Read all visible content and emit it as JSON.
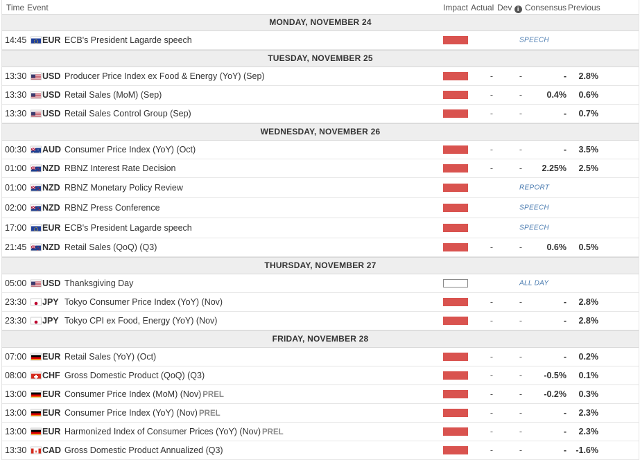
{
  "header": {
    "time": "Time",
    "event": "Event",
    "impact": "Impact",
    "actual": "Actual",
    "dev": "Dev",
    "consensus": "Consensus",
    "previous": "Previous"
  },
  "days": [
    {
      "label": "MONDAY, NOVEMBER 24",
      "rows": [
        {
          "time": "14:45",
          "flag": "EU",
          "currency": "EUR",
          "event": "ECB's President Lagarde speech",
          "prel": "",
          "impact": "high",
          "tag": "SPEECH",
          "actual": "",
          "dev": "",
          "consensus": "",
          "previous": ""
        }
      ]
    },
    {
      "label": "TUESDAY, NOVEMBER 25",
      "rows": [
        {
          "time": "13:30",
          "flag": "US",
          "currency": "USD",
          "event": "Producer Price Index ex Food & Energy (YoY) (Sep)",
          "prel": "",
          "impact": "high",
          "tag": "",
          "actual": "-",
          "dev": "-",
          "consensus": "-",
          "previous": "2.8%"
        },
        {
          "time": "13:30",
          "flag": "US",
          "currency": "USD",
          "event": "Retail Sales (MoM) (Sep)",
          "prel": "",
          "impact": "high",
          "tag": "",
          "actual": "-",
          "dev": "-",
          "consensus": "0.4%",
          "previous": "0.6%"
        },
        {
          "time": "13:30",
          "flag": "US",
          "currency": "USD",
          "event": "Retail Sales Control Group (Sep)",
          "prel": "",
          "impact": "high",
          "tag": "",
          "actual": "-",
          "dev": "-",
          "consensus": "-",
          "previous": "0.7%"
        }
      ]
    },
    {
      "label": "WEDNESDAY, NOVEMBER 26",
      "rows": [
        {
          "time": "00:30",
          "flag": "AU",
          "currency": "AUD",
          "event": "Consumer Price Index (YoY) (Oct)",
          "prel": "",
          "impact": "high",
          "tag": "",
          "actual": "-",
          "dev": "-",
          "consensus": "-",
          "previous": "3.5%"
        },
        {
          "time": "01:00",
          "flag": "NZ",
          "currency": "NZD",
          "event": "RBNZ Interest Rate Decision",
          "prel": "",
          "impact": "high",
          "tag": "",
          "actual": "-",
          "dev": "-",
          "consensus": "2.25%",
          "previous": "2.5%"
        },
        {
          "time": "01:00",
          "flag": "NZ",
          "currency": "NZD",
          "event": "RBNZ Monetary Policy Review",
          "prel": "",
          "impact": "high",
          "tag": "REPORT",
          "actual": "",
          "dev": "",
          "consensus": "",
          "previous": "",
          "tall": true
        },
        {
          "time": "02:00",
          "flag": "NZ",
          "currency": "NZD",
          "event": "RBNZ Press Conference",
          "prel": "",
          "impact": "high",
          "tag": "SPEECH",
          "actual": "",
          "dev": "",
          "consensus": "",
          "previous": "",
          "tall": true
        },
        {
          "time": "17:00",
          "flag": "EU",
          "currency": "EUR",
          "event": "ECB's President Lagarde speech",
          "prel": "",
          "impact": "high",
          "tag": "SPEECH",
          "actual": "",
          "dev": "",
          "consensus": "",
          "previous": "",
          "tall": true
        },
        {
          "time": "21:45",
          "flag": "NZ",
          "currency": "NZD",
          "event": "Retail Sales (QoQ) (Q3)",
          "prel": "",
          "impact": "high",
          "tag": "",
          "actual": "-",
          "dev": "-",
          "consensus": "0.6%",
          "previous": "0.5%"
        }
      ]
    },
    {
      "label": "THURSDAY, NOVEMBER 27",
      "rows": [
        {
          "time": "05:00",
          "flag": "US",
          "currency": "USD",
          "event": "Thanksgiving Day",
          "prel": "",
          "impact": "low",
          "tag": "ALL DAY",
          "actual": "",
          "dev": "",
          "consensus": "",
          "previous": ""
        },
        {
          "time": "23:30",
          "flag": "JP",
          "currency": "JPY",
          "event": "Tokyo Consumer Price Index (YoY) (Nov)",
          "prel": "",
          "impact": "high",
          "tag": "",
          "actual": "-",
          "dev": "-",
          "consensus": "-",
          "previous": "2.8%"
        },
        {
          "time": "23:30",
          "flag": "JP",
          "currency": "JPY",
          "event": "Tokyo CPI ex Food, Energy (YoY) (Nov)",
          "prel": "",
          "impact": "high",
          "tag": "",
          "actual": "-",
          "dev": "-",
          "consensus": "-",
          "previous": "2.8%"
        }
      ]
    },
    {
      "label": "FRIDAY, NOVEMBER 28",
      "rows": [
        {
          "time": "07:00",
          "flag": "DE",
          "currency": "EUR",
          "event": "Retail Sales (YoY) (Oct)",
          "prel": "",
          "impact": "high",
          "tag": "",
          "actual": "-",
          "dev": "-",
          "consensus": "-",
          "previous": "0.2%"
        },
        {
          "time": "08:00",
          "flag": "CH",
          "currency": "CHF",
          "event": "Gross Domestic Product (QoQ) (Q3)",
          "prel": "",
          "impact": "high",
          "tag": "",
          "actual": "-",
          "dev": "-",
          "consensus": "-0.5%",
          "previous": "0.1%"
        },
        {
          "time": "13:00",
          "flag": "DE",
          "currency": "EUR",
          "event": "Consumer Price Index (MoM) (Nov)",
          "prel": "PREL",
          "impact": "high",
          "tag": "",
          "actual": "-",
          "dev": "-",
          "consensus": "-0.2%",
          "previous": "0.3%"
        },
        {
          "time": "13:00",
          "flag": "DE",
          "currency": "EUR",
          "event": "Consumer Price Index (YoY) (Nov)",
          "prel": "PREL",
          "impact": "high",
          "tag": "",
          "actual": "-",
          "dev": "-",
          "consensus": "-",
          "previous": "2.3%"
        },
        {
          "time": "13:00",
          "flag": "DE",
          "currency": "EUR",
          "event": "Harmonized Index of Consumer Prices (YoY) (Nov)",
          "prel": "PREL",
          "impact": "high",
          "tag": "",
          "actual": "-",
          "dev": "-",
          "consensus": "-",
          "previous": "2.3%"
        },
        {
          "time": "13:30",
          "flag": "CA",
          "currency": "CAD",
          "event": "Gross Domestic Product Annualized (Q3)",
          "prel": "",
          "impact": "high",
          "tag": "",
          "actual": "-",
          "dev": "-",
          "consensus": "-",
          "previous": "-1.6%"
        }
      ]
    }
  ],
  "colors": {
    "impact_high": "#d9534f",
    "tag": "#4a7bb0",
    "day_bg": "#eeeeee"
  }
}
